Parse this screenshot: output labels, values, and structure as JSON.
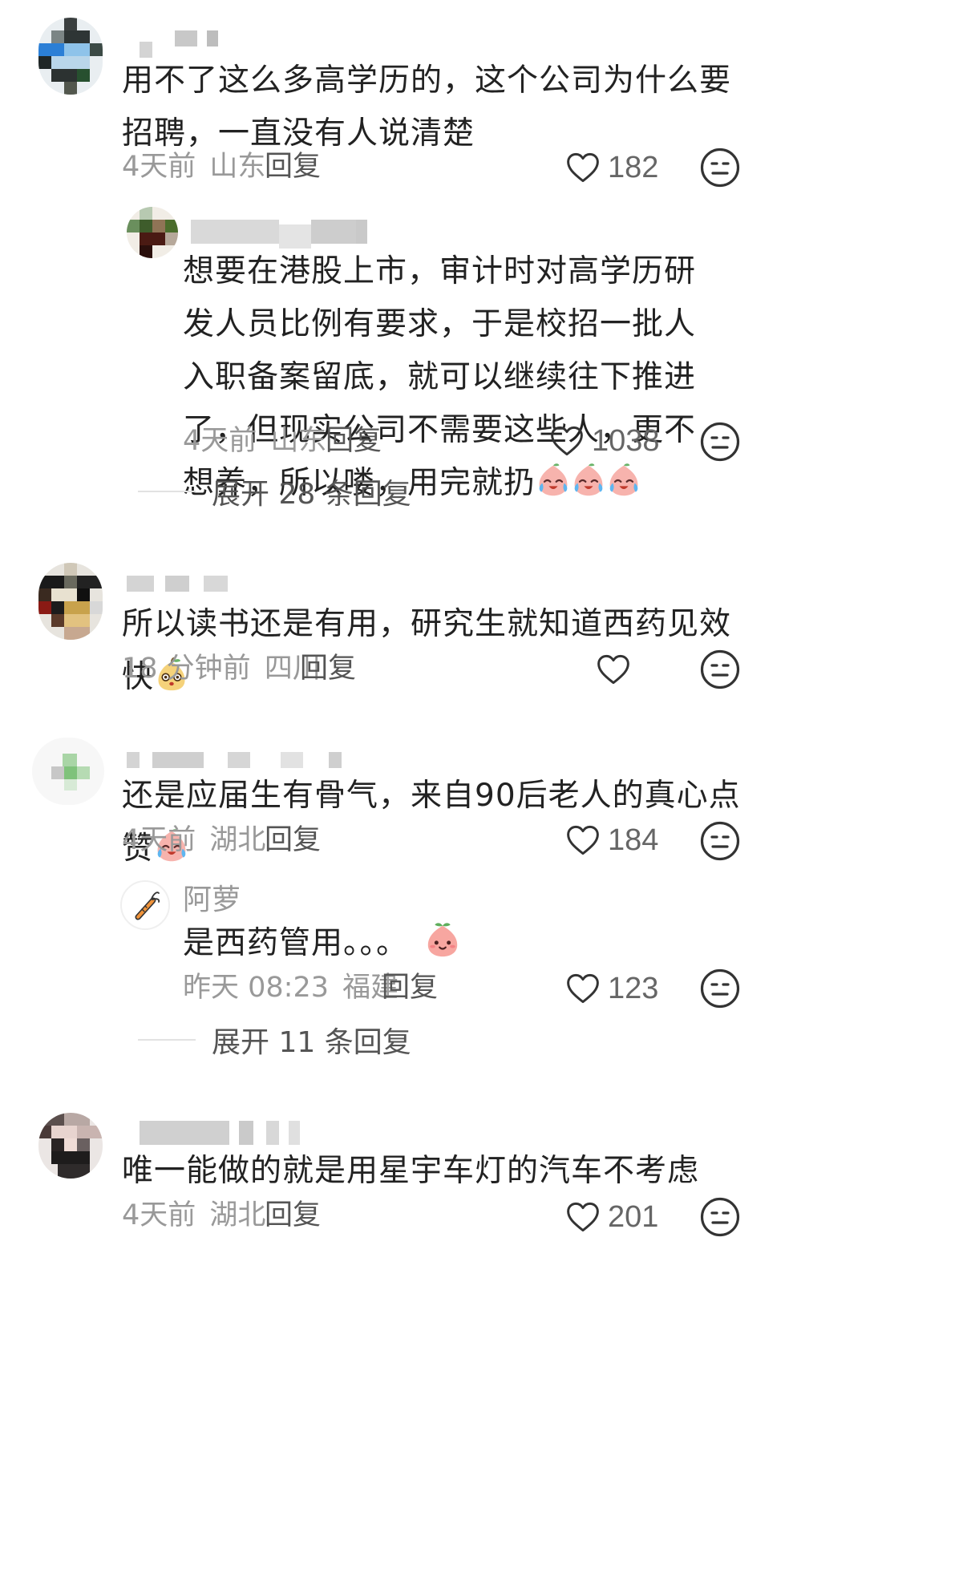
{
  "comments": [
    {
      "text": "用不了这么多高学历的，这个公司为什么要招聘，一直没有人说清楚",
      "time": "4天前",
      "location": "山东",
      "reply_label": "回复",
      "likes": "182",
      "replies": [
        {
          "text": "想要在港股上市，审计时对高学历研发人员比例有要求，于是校招一批人入职备案留底，就可以继续往下推进了，但现实公司不需要这些人，更不想养，所以喽，用完就扔",
          "time": "4天前",
          "location": "山东",
          "reply_label": "回复",
          "likes": "1038"
        }
      ],
      "expand_label": "展开 28 条回复"
    },
    {
      "text": "所以读书还是有用，研究生就知道西药见效快",
      "time": "18 分钟前",
      "location": "四川",
      "reply_label": "回复",
      "likes": ""
    },
    {
      "text": "还是应届生有骨气，来自90后老人的真心点赞",
      "time": "4天前",
      "location": "湖北",
      "reply_label": "回复",
      "likes": "184",
      "replies": [
        {
          "author": "阿萝",
          "text": "是西药管用。。。",
          "time": "昨天 08:23",
          "location": "福建",
          "reply_label": "回复",
          "likes": "123"
        }
      ],
      "expand_label": "展开 11 条回复"
    },
    {
      "text": "唯一能做的就是用星宇车灯的汽车不考虑",
      "time": "4天前",
      "location": "湖北",
      "reply_label": "回复",
      "likes": "201"
    }
  ],
  "icons": {
    "like": "heart-outline-icon",
    "dislike": "neutral-face-icon",
    "emoji_cry": "crying-laughing-peach-emoji",
    "emoji_peach": "smiling-peach-emoji",
    "emoji_pear": "pear-face-emoji",
    "avatar_carrot": "carrot-icon"
  },
  "colors": {
    "text": "#222222",
    "meta": "#999999",
    "icon": "#333333",
    "divider": "#e2e2e2"
  }
}
